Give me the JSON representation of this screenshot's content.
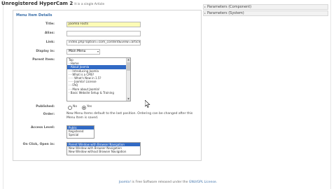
{
  "watermark": {
    "title": "Unregistered HyperCam 2",
    "subtitle": "It is a single Article"
  },
  "form": {
    "legend": "Menu Item Details",
    "title": {
      "label": "Title:",
      "value": "Joomla Facts"
    },
    "alias": {
      "label": "Alias:",
      "value": ""
    },
    "link": {
      "label": "Link:",
      "value": "index.php?option=com_content&view=article"
    },
    "display_in": {
      "label": "Display in:",
      "value": "Main Menu"
    },
    "parent_item": {
      "label": "Parent Item:",
      "options": [
        "Top",
        "- Home",
        "- About Joomla",
        "- - Introducing Joomla",
        "- - What is a CMS?",
        "- - - What's New in 1.5?",
        "- - - Joomla! License",
        "- - FAQ",
        "- - More about Joomla!",
        "- Basic Website Setup & Training"
      ],
      "selected_index": 2
    },
    "published": {
      "label": "Published:",
      "no": "No",
      "yes": "Yes",
      "value": "Yes"
    },
    "order": {
      "label": "Order:",
      "text": "New Menu Items default to the last position. Ordering can be changed after this Menu Item is saved."
    },
    "access": {
      "label": "Access Level:",
      "options": [
        "Public",
        "Registered",
        "Special"
      ],
      "selected_index": 0
    },
    "on_click": {
      "label": "On Click, Open in:",
      "options": [
        "Parent Window with Browser Navigation",
        "New Window with Browser Navigation",
        "New Window without Browser Navigation"
      ],
      "selected_index": 0
    }
  },
  "right_panels": [
    "Parameters (Component)",
    "Parameters (System)"
  ],
  "footer": {
    "link_text": "Joomla!",
    "text": " is Free Software released under the ",
    "license": "GNU/GPL License."
  }
}
